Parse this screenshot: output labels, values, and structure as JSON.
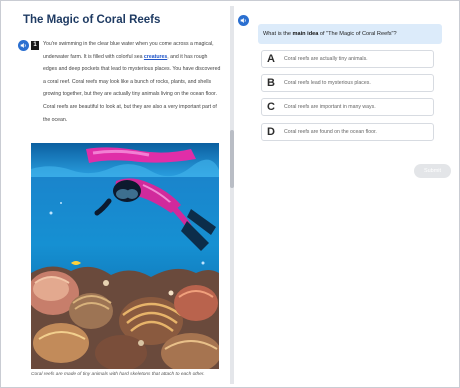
{
  "passage": {
    "title": "The Magic of Coral Reefs",
    "paragraph_number": "1",
    "text_before": "You're swimming in the clear blue water when you come across a magical, underwater farm. It is filled with colorful sea ",
    "vocab_word": "creatures",
    "text_after": ", and it has rough edges and deep pockets that lead to mysterious places. You have discovered a coral reef. Coral reefs may look like a bunch of rocks, plants, and shells growing together, but they are actually tiny animals living on the ocean floor. Coral reefs are beautiful to look at, but they are also a very important part of the ocean.",
    "caption": "Coral reefs are made of tiny animals with hard skeletons that attach to each other."
  },
  "question": {
    "prefix": "What is the ",
    "bold": "main idea",
    "suffix": " of \"The Magic of Coral Reefs\"?",
    "choices": [
      {
        "letter": "A",
        "text": "Coral reefs are actually tiny animals."
      },
      {
        "letter": "B",
        "text": "Coral reefs lead to mysterious places."
      },
      {
        "letter": "C",
        "text": "Coral reefs are important in many ways."
      },
      {
        "letter": "D",
        "text": "Coral reefs are found on the ocean floor."
      }
    ],
    "submit_label": "Submit"
  },
  "icons": {
    "audio": "speaker-icon"
  },
  "colors": {
    "accent": "#2a6fd0",
    "title": "#1f3b63",
    "question_bg": "#dcebfa",
    "vocab": "#1f54c8"
  }
}
